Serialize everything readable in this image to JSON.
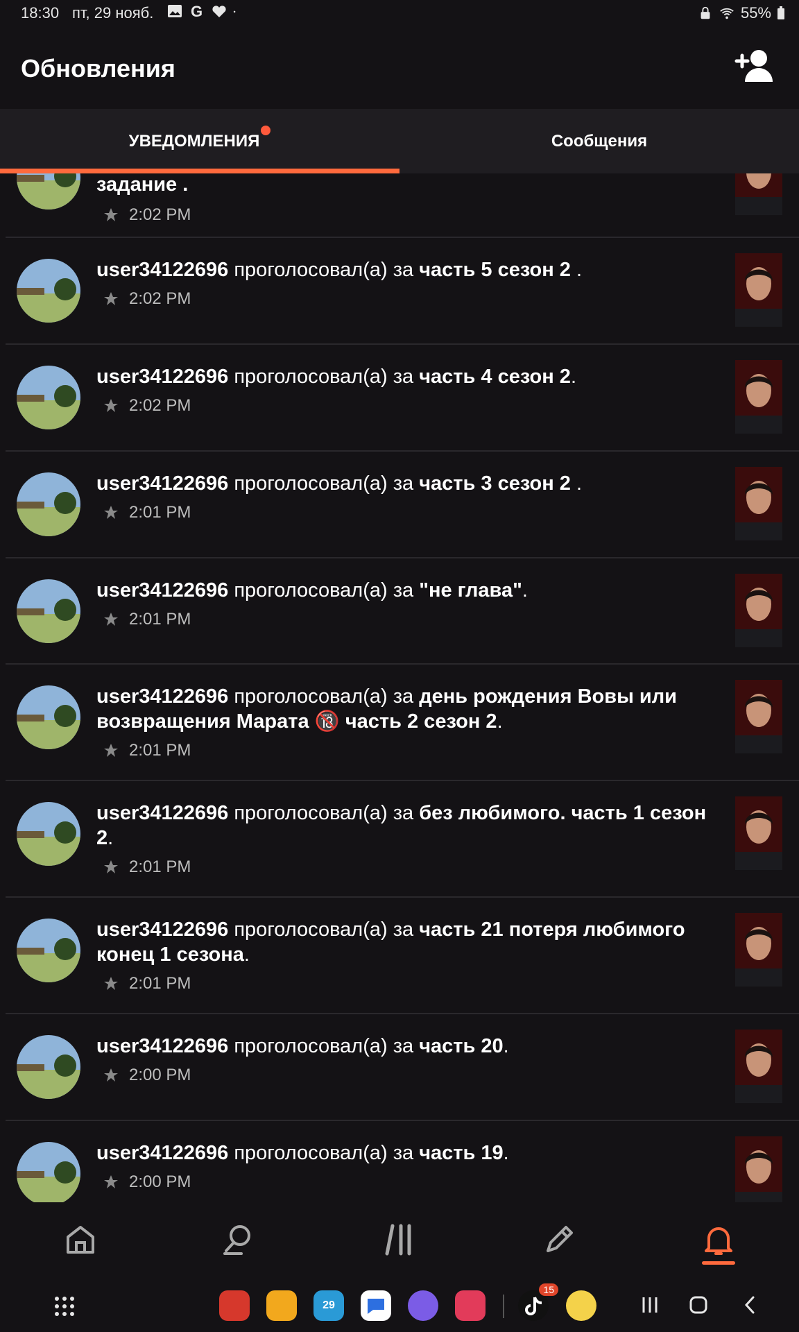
{
  "status_bar": {
    "time": "18:30",
    "date": "пт, 29 нояб.",
    "battery": "55%"
  },
  "header": {
    "title": "Обновления",
    "add_icon": "add-user-icon"
  },
  "tabs": [
    {
      "label": "УВЕДОМЛЕНИЯ",
      "active": true,
      "has_dot": true
    },
    {
      "label": "Сообщения",
      "active": false,
      "has_dot": false
    }
  ],
  "notifications": [
    {
      "user": "",
      "verb": "",
      "title": "задание .",
      "time": "2:02 PM"
    },
    {
      "user": "user34122696",
      "verb": " проголосовал(а) за ",
      "title": "часть 5 сезон 2",
      "suffix": " .",
      "time": "2:02 PM"
    },
    {
      "user": "user34122696",
      "verb": " проголосовал(а) за ",
      "title": "часть 4 сезон 2",
      "suffix": ".",
      "time": "2:02 PM"
    },
    {
      "user": "user34122696",
      "verb": " проголосовал(а) за ",
      "title": "часть 3 сезон 2",
      "suffix": " .",
      "time": "2:01 PM"
    },
    {
      "user": "user34122696",
      "verb": " проголосовал(а) за ",
      "title": "\"не глава\"",
      "suffix": ".",
      "time": "2:01 PM"
    },
    {
      "user": "user34122696",
      "verb": " проголосовал(а) за ",
      "title": "день рождения Вовы или возвращения Марата 🔞 часть 2 сезон 2",
      "suffix": ".",
      "time": "2:01 PM"
    },
    {
      "user": "user34122696",
      "verb": " проголосовал(а) за ",
      "title": "без любимого. часть 1 сезон 2",
      "suffix": ".",
      "time": "2:01 PM"
    },
    {
      "user": "user34122696",
      "verb": " проголосовал(а) за ",
      "title": "часть 21 потеря любимого конец 1 сезона",
      "suffix": ".",
      "time": "2:01 PM"
    },
    {
      "user": "user34122696",
      "verb": " проголосовал(а) за ",
      "title": "часть 20",
      "suffix": ".",
      "time": "2:00 PM"
    },
    {
      "user": "user34122696",
      "verb": " проголосовал(а) за ",
      "title": "часть 19",
      "suffix": ".",
      "time": "2:00 PM"
    }
  ],
  "bottom_nav": [
    {
      "name": "home-icon",
      "active": false
    },
    {
      "name": "search-icon",
      "active": false
    },
    {
      "name": "library-icon",
      "active": false
    },
    {
      "name": "write-icon",
      "active": false
    },
    {
      "name": "notifications-bell-icon",
      "active": true
    }
  ],
  "dock": {
    "tiktok_badge": "15",
    "calendar_day": "29"
  },
  "colors": {
    "accent": "#ff6a3d",
    "background": "#141215",
    "tab_bar": "#1f1d21",
    "divider": "#2a282c"
  }
}
